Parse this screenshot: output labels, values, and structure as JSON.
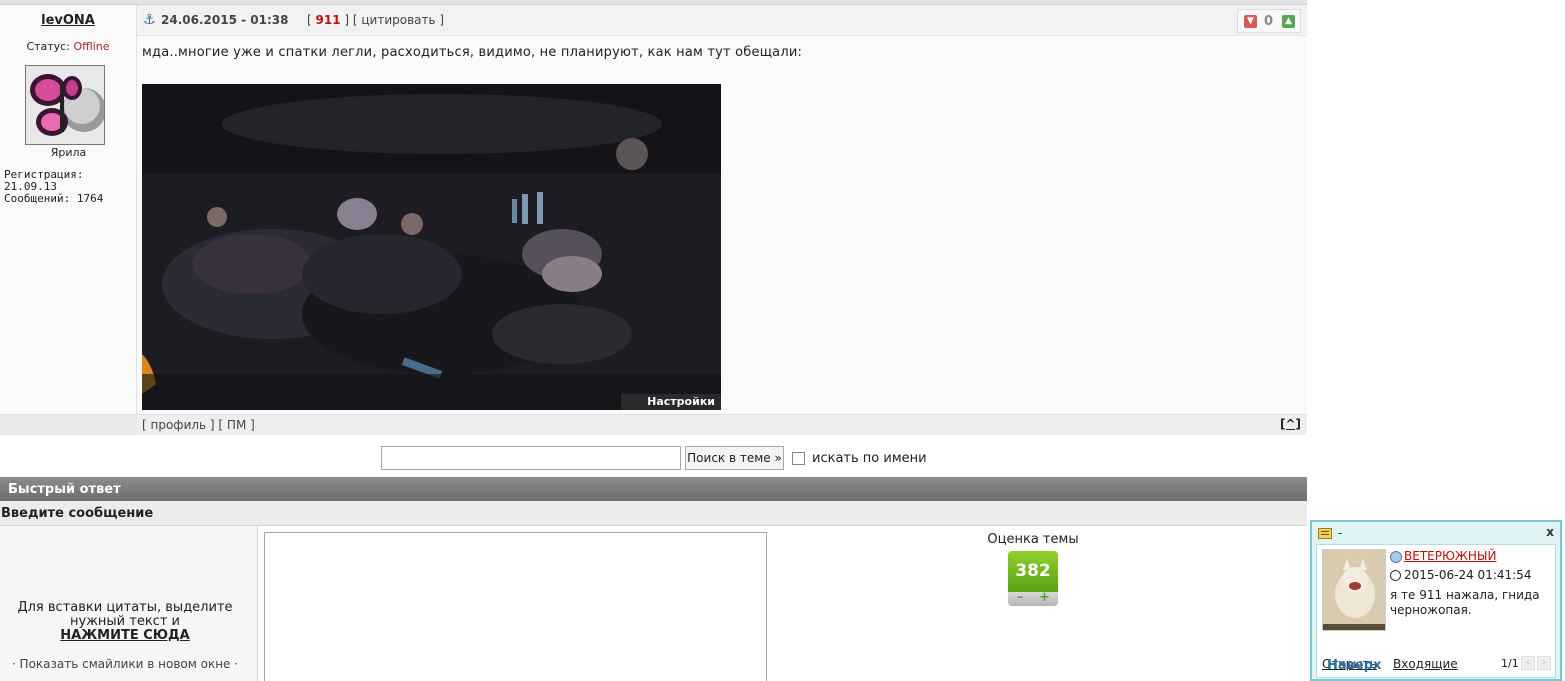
{
  "post": {
    "author": "levONA",
    "status_label": "Статус:",
    "status_value": "Offline",
    "rank": "Ярила",
    "registration": "Регистрация: 21.09.13",
    "messages": "Сообщений: 1764",
    "date": "24.06.2015 - 01:38",
    "post_number": "911",
    "quote_label": "цитировать",
    "rating_count": "0",
    "text": "мда..многие уже и спатки легли, расходиться, видимо, не планируют, как нам тут обещали:",
    "image_settings_label": "Настройки",
    "profile_link": "профиль",
    "pm_link": "ПМ",
    "top_link": "[^]"
  },
  "search": {
    "button_label": "Поиск в теме »",
    "by_name_label": "искать по имени",
    "input_value": ""
  },
  "quick_reply": {
    "header": "Быстрый ответ",
    "subheader": "Введите сообщение",
    "hint_line1": "Для вставки цитаты, выделите",
    "hint_line2": "нужный текст и",
    "hint_action": "НАЖМИТЕ СЮДА",
    "smiles_link": "Показать смайлики в новом окне",
    "textarea_value": ""
  },
  "topic_rating": {
    "title": "Оценка темы",
    "value": "382",
    "minus": "–",
    "plus": "+"
  },
  "notification": {
    "title": "-",
    "close": "x",
    "user": "ВЕТЕРЮЖНЫЙ",
    "time": "2015-06-24 01:41:54",
    "message": "я те 911 нажала, гнида черножопая.",
    "open_label": "Открыть",
    "inbox_label": "Входящие",
    "page": "1/1"
  },
  "naverh_label": "Наверх",
  "colors": {
    "accent_red": "#c01010",
    "rating_green": "#6bb51a",
    "notif_border": "#7fc7cf"
  }
}
